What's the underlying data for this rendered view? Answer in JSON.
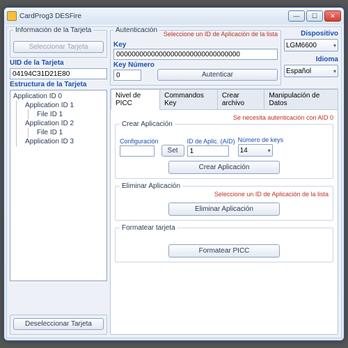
{
  "window": {
    "title": "CardProg3 DESFire"
  },
  "left": {
    "info_legend": "Información de la Tarjeta",
    "select_card": "Seleccionar Tarjeta",
    "uid_label": "UID de la Tarjeta",
    "uid_value": "04194C31D21E80",
    "struct_label": "Estructura de la Tarjeta",
    "tree": {
      "root": "Application ID 0",
      "items": [
        {
          "label": "Application ID 1",
          "children": [
            "File ID 1"
          ]
        },
        {
          "label": "Application ID 2",
          "children": [
            "File ID 1"
          ]
        },
        {
          "label": "Application ID 3",
          "children": []
        }
      ]
    },
    "deselect": "Deseleccionar Tarjeta"
  },
  "auth": {
    "legend": "Autenticación",
    "warn": "Seleccione un ID de Aplicación de la lista",
    "key_label": "Key",
    "key_value": "00000000000000000000000000000000",
    "keynum_label": "Key Número",
    "keynum_value": "0",
    "auth_btn": "Autenticar"
  },
  "right_side": {
    "device_label": "Dispositivo",
    "device_value": "LGM6600",
    "lang_label": "Idioma",
    "lang_value": "Español"
  },
  "tabs": {
    "picc": "Nivel de PICC",
    "cmdkey": "Commandos Key",
    "create": "Crear archivo",
    "data": "Manipulación de Datos"
  },
  "picc": {
    "warn": "Se necesita autenticación con AID 0",
    "create_legend": "Crear Aplicación",
    "config_label": "Configuración",
    "set_btn": "Set",
    "aid_label": "ID de Aplic. (AID)",
    "aid_value": "1",
    "numkeys_label": "Número de keys",
    "numkeys_value": "14",
    "create_btn": "Crear Aplicación",
    "delete_legend": "Eliminar Aplicación",
    "delete_warn": "Seleccione un ID de Aplicación de la lista",
    "delete_btn": "Eliminar Aplicación",
    "format_legend": "Formatear tarjeta",
    "format_btn": "Formatear PICC"
  }
}
